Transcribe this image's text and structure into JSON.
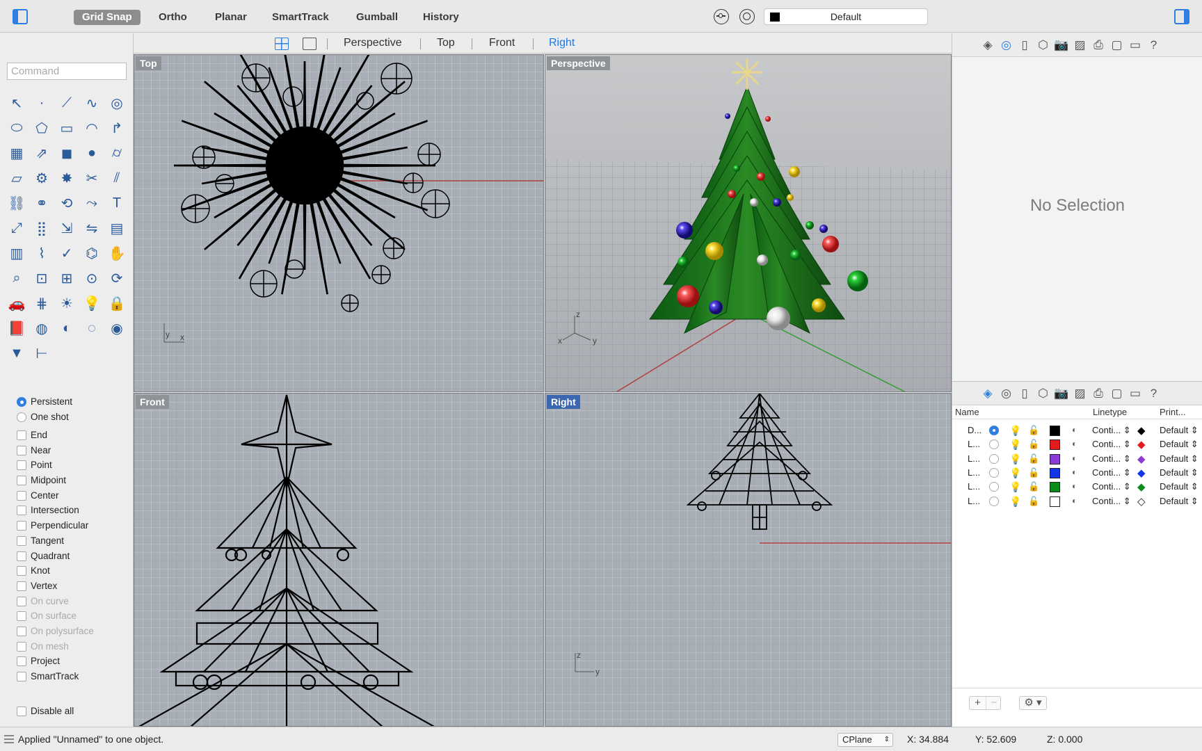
{
  "toolbar": {
    "modes": [
      "Grid Snap",
      "Ortho",
      "Planar",
      "SmartTrack",
      "Gumball",
      "History"
    ],
    "active_mode": "Grid Snap",
    "layer": "Default",
    "layer_color": "#000000"
  },
  "command": {
    "placeholder": "Command"
  },
  "tools": [
    "select-arrow-icon",
    "point-icon",
    "polyline-icon",
    "curve-icon",
    "circle-icon",
    "ellipse-icon",
    "polygon-icon",
    "rectangle-icon",
    "arc-icon",
    "fillet-icon",
    "surface-icon",
    "extrude-icon",
    "box-icon",
    "sphere-icon",
    "cylinder-icon",
    "plane-icon",
    "gear-icon",
    "explode-icon",
    "trim-icon",
    "split-icon",
    "join-icon",
    "group-icon",
    "offset-icon",
    "blend-icon",
    "text-icon",
    "transform-icon",
    "array-icon",
    "scale-icon",
    "mirror-icon",
    "grid-icon",
    "patch-icon",
    "curve-tool-icon",
    "check-icon",
    "analyze-icon",
    "pan-icon",
    "zoom-icon",
    "zoom-window-icon",
    "zoom-extents-icon",
    "zoom-selected-icon",
    "rotate-view-icon",
    "car-icon",
    "mesh-icon",
    "light-icon",
    "bulb-icon",
    "lock-icon",
    "book-icon",
    "color-wheel-icon",
    "shade-icon",
    "wireframe-icon",
    "material-icon",
    "render-icon",
    "dimension-icon"
  ],
  "snap_modes": {
    "persistent": "Persistent",
    "one_shot": "One shot",
    "persistent_selected": true
  },
  "osnaps": [
    {
      "label": "End",
      "enabled": true
    },
    {
      "label": "Near",
      "enabled": true
    },
    {
      "label": "Point",
      "enabled": true
    },
    {
      "label": "Midpoint",
      "enabled": true
    },
    {
      "label": "Center",
      "enabled": true
    },
    {
      "label": "Intersection",
      "enabled": true
    },
    {
      "label": "Perpendicular",
      "enabled": true
    },
    {
      "label": "Tangent",
      "enabled": true
    },
    {
      "label": "Quadrant",
      "enabled": true
    },
    {
      "label": "Knot",
      "enabled": true
    },
    {
      "label": "Vertex",
      "enabled": true
    },
    {
      "label": "On curve",
      "enabled": false
    },
    {
      "label": "On surface",
      "enabled": false
    },
    {
      "label": "On polysurface",
      "enabled": false
    },
    {
      "label": "On mesh",
      "enabled": false
    },
    {
      "label": "Project",
      "enabled": true
    },
    {
      "label": "SmartTrack",
      "enabled": true
    }
  ],
  "disable_all": "Disable all",
  "viewport_tabs": [
    "Perspective",
    "Top",
    "Front",
    "Right"
  ],
  "active_viewport_tab": "Right",
  "viewports": {
    "top": "Top",
    "perspective": "Perspective",
    "front": "Front",
    "right": "Right"
  },
  "axis_labels": {
    "x": "x",
    "y": "y",
    "z": "z"
  },
  "properties": {
    "empty": "No Selection"
  },
  "panel_icons": [
    "layers-icon",
    "display-icon",
    "document-icon",
    "object-icon",
    "camera-icon",
    "material-icon",
    "render-icon",
    "blank-icon",
    "monitor-icon",
    "help-icon"
  ],
  "layers": {
    "headers": {
      "name": "Name",
      "linetype": "Linetype",
      "print": "Print..."
    },
    "rows": [
      {
        "name": "D...",
        "color": "#000000",
        "linetype": "Conti...",
        "print": "Default",
        "current": true
      },
      {
        "name": "L...",
        "color": "#e21c1c",
        "linetype": "Conti...",
        "print": "Default",
        "current": false
      },
      {
        "name": "L...",
        "color": "#8b3bd6",
        "linetype": "Conti...",
        "print": "Default",
        "current": false
      },
      {
        "name": "L...",
        "color": "#1236e8",
        "linetype": "Conti...",
        "print": "Default",
        "current": false
      },
      {
        "name": "L...",
        "color": "#0a8c1a",
        "linetype": "Conti...",
        "print": "Default",
        "current": false
      },
      {
        "name": "L...",
        "color": "#ffffff",
        "linetype": "Conti...",
        "print": "Default",
        "current": false
      }
    ]
  },
  "status": {
    "message": "Applied \"Unnamed\" to one object.",
    "cplane": "CPlane",
    "x": "X: 34.884",
    "y": "Y: 52.609",
    "z": "Z: 0.000"
  }
}
